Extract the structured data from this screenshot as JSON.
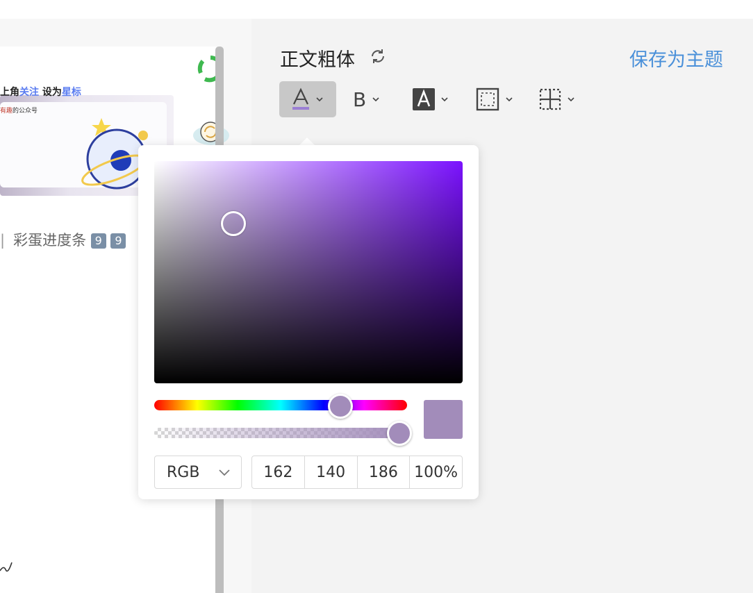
{
  "article": {
    "banner_line1_a": "上角",
    "banner_line1_b": "关注",
    "banner_line1_c": "  设为",
    "banner_line1_d": "星标",
    "banner_line2_a": "有趣",
    "banner_line2_b": "的公众号",
    "caption_separator": "|",
    "caption_text": "彩蛋进度条",
    "caption_keys": [
      "9",
      "9"
    ]
  },
  "panel": {
    "title": "正文粗体",
    "save_theme_label": "保存为主题"
  },
  "toolbar": {
    "bold_label": "B",
    "items": [
      "font-color",
      "bold",
      "background-color",
      "border",
      "spacing"
    ],
    "active_item": "font-color"
  },
  "color_picker": {
    "mode": "RGB",
    "r": "162",
    "g": "140",
    "b": "186",
    "alpha": "100%",
    "current_color": "#a28cba",
    "hue_color": "#7b12ff"
  },
  "colors": {
    "accent_link": "#4a90d9",
    "font_color_underline": "#9b7fd4"
  }
}
